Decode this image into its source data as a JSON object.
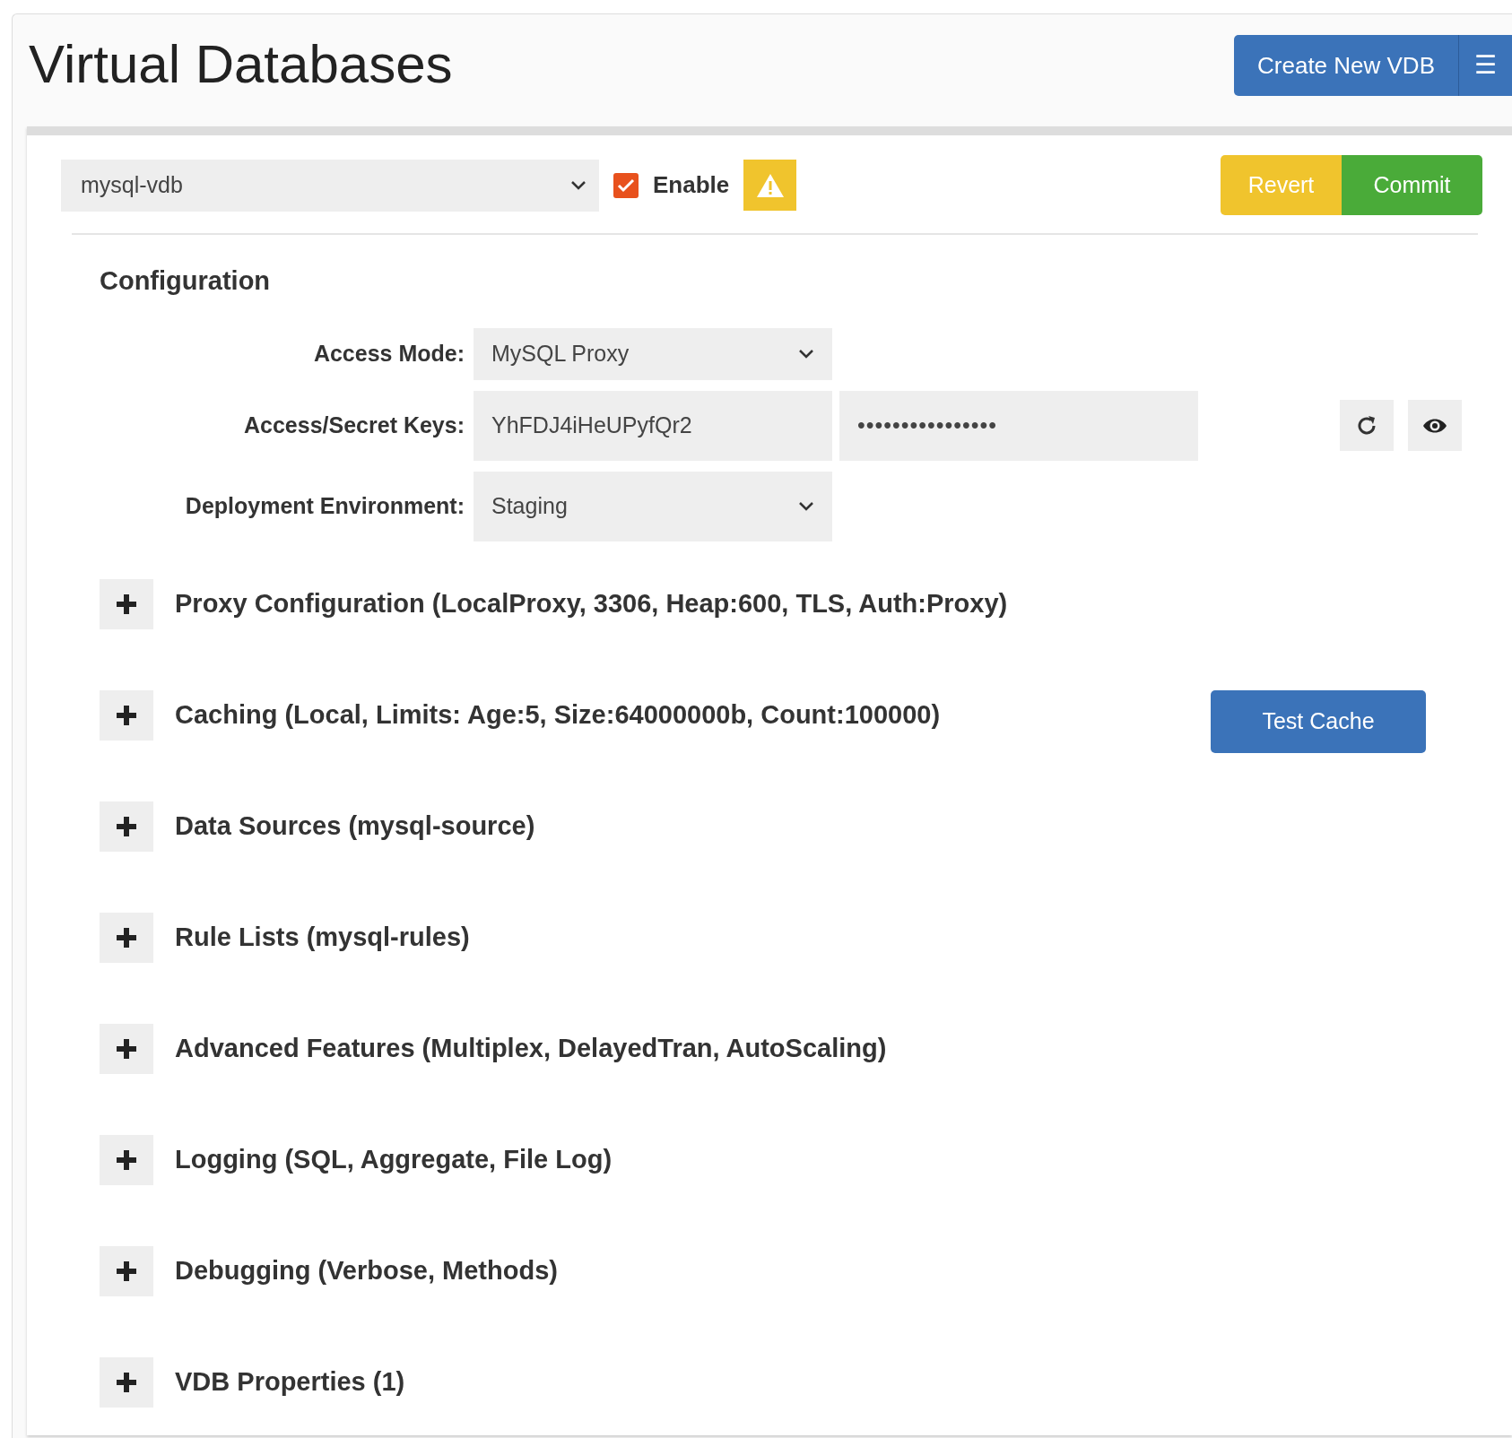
{
  "page": {
    "title": "Virtual Databases"
  },
  "header_buttons": {
    "create": "Create New VDB",
    "menu": "☰"
  },
  "toolbar": {
    "vdb_select": "mysql-vdb",
    "enable": {
      "label": "Enable",
      "checked": true
    },
    "warning": true,
    "revert": "Revert",
    "commit": "Commit"
  },
  "configuration": {
    "heading": "Configuration",
    "fields": [
      {
        "kind": "select",
        "label": "Access Mode:",
        "value": "MySQL Proxy"
      },
      {
        "kind": "keys",
        "label": "Access/Secret Keys:",
        "value": "YhFDJ4iHeUPyfQr2",
        "secret": "••••••••••••••••"
      },
      {
        "kind": "select",
        "label": "Deployment Environment:",
        "value": "Staging"
      }
    ]
  },
  "sections": [
    {
      "title": "Proxy Configuration (LocalProxy, 3306, Heap:600, TLS, Auth:Proxy)",
      "expanded": false
    },
    {
      "title": "Caching (Local, Limits: Age:5, Size:64000000b, Count:100000)",
      "expanded": false,
      "action": "Test Cache"
    },
    {
      "title": "Data Sources (mysql-source)",
      "expanded": false
    },
    {
      "title": "Rule Lists (mysql-rules)",
      "expanded": false
    },
    {
      "title": "Advanced Features (Multiplex, DelayedTran, AutoScaling)",
      "expanded": false
    },
    {
      "title": "Logging (SQL, Aggregate, File Log)",
      "expanded": false
    },
    {
      "title": "Debugging (Verbose, Methods)",
      "expanded": false
    },
    {
      "title": "VDB Properties (1)",
      "expanded": false
    }
  ]
}
